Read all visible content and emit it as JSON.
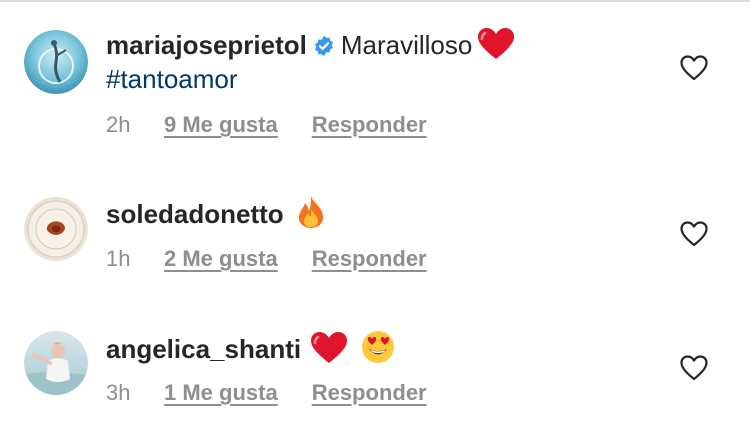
{
  "comments": [
    {
      "username": "mariajoseprietol",
      "verified": true,
      "text": "Maravilloso",
      "hashtag": "#tantoamor",
      "time": "2h",
      "likes": "9 Me gusta",
      "reply": "Responder",
      "emojis": [
        "red-heart"
      ]
    },
    {
      "username": "soledadonetto",
      "verified": false,
      "time": "1h",
      "likes": "2 Me gusta",
      "reply": "Responder",
      "emojis": [
        "fire"
      ]
    },
    {
      "username": "angelica_shanti",
      "verified": false,
      "time": "3h",
      "likes": "1 Me gusta",
      "reply": "Responder",
      "emojis": [
        "red-heart",
        "heart-eyes-face"
      ]
    }
  ],
  "colors": {
    "username": "#262626",
    "hashtag": "#00376b",
    "meta": "#8e8e8e",
    "verified": "#3897f0",
    "heart_emoji": "#e0142b"
  }
}
